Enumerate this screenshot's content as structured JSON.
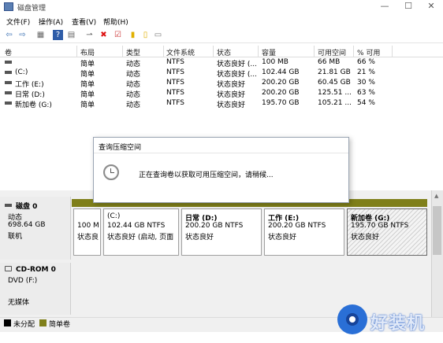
{
  "window": {
    "title": "磁盘管理",
    "minimize_glyph": "—",
    "maximize_glyph": "☐",
    "close_glyph": "✕"
  },
  "menu": [
    "文件(F)",
    "操作(A)",
    "查看(V)",
    "帮助(H)"
  ],
  "toolbar": {
    "icons": [
      "back-arrow-icon",
      "forward-arrow-icon",
      "console-tree-icon",
      "help-icon",
      "properties-icon",
      "connect-icon",
      "delete-icon",
      "check-icon",
      "folder-open-icon",
      "refresh-icon",
      "view-icon"
    ],
    "glyphs": [
      "⇦",
      "⇨",
      "▦",
      "?",
      "▤",
      "⇀",
      "✖",
      "☑",
      "▮",
      "▯",
      "▭"
    ]
  },
  "volume_table": {
    "headers": [
      "卷",
      "布局",
      "类型",
      "文件系统",
      "状态",
      "容量",
      "可用空间",
      "% 可用"
    ],
    "rows": [
      [
        "",
        "简单",
        "动态",
        "NTFS",
        "状态良好 (...",
        "100 MB",
        "66 MB",
        "66 %"
      ],
      [
        "(C:)",
        "简单",
        "动态",
        "NTFS",
        "状态良好 (...",
        "102.44 GB",
        "21.81 GB",
        "21 %"
      ],
      [
        "工作 (E:)",
        "简单",
        "动态",
        "NTFS",
        "状态良好",
        "200.20 GB",
        "60.45 GB",
        "30 %"
      ],
      [
        "日常 (D:)",
        "简单",
        "动态",
        "NTFS",
        "状态良好",
        "200.20 GB",
        "125.51 ...",
        "63 %"
      ],
      [
        "新加卷 (G:)",
        "简单",
        "动态",
        "NTFS",
        "状态良好",
        "195.70 GB",
        "105.21 ...",
        "54 %"
      ]
    ]
  },
  "disks": [
    {
      "name": "磁盘 0",
      "type": "动态",
      "size": "698.64 GB",
      "status": "联机",
      "partitions": [
        {
          "name": "",
          "size_fs": "100 M",
          "status": "状态良"
        },
        {
          "name": "(C:)",
          "size_fs": "102.44 GB NTFS",
          "status": "状态良好 (启动, 页面"
        },
        {
          "name": "日常 (D:)",
          "size_fs": "200.20 GB NTFS",
          "status": "状态良好"
        },
        {
          "name": "工作 (E:)",
          "size_fs": "200.20 GB NTFS",
          "status": "状态良好"
        },
        {
          "name": "新加卷 (G:)",
          "size_fs": "195.70 GB NTFS",
          "status": "状态良好"
        }
      ]
    },
    {
      "name": "CD-ROM 0",
      "type": "DVD (F:)",
      "status": "无媒体"
    }
  ],
  "legend": [
    {
      "label": "未分配",
      "color": "#000000"
    },
    {
      "label": "简单卷",
      "color": "#7f7f1a"
    }
  ],
  "dialog": {
    "title": "查询压缩空间",
    "message": "正在查询卷以获取可用压缩空间，请稍候...",
    "icon": "clock-icon"
  },
  "watermark": {
    "text": "好装机",
    "icon": "watermark-logo-icon"
  }
}
